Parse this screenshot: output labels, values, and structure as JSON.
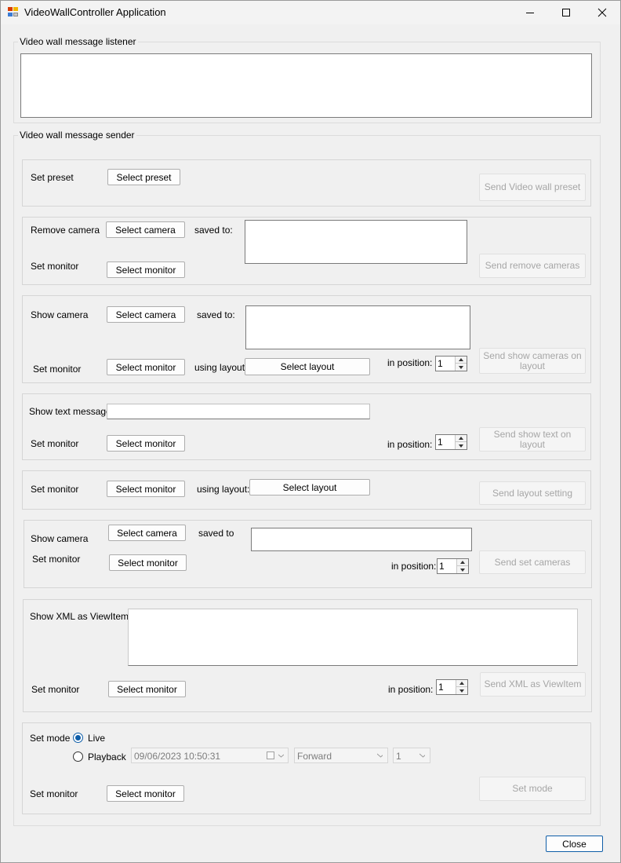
{
  "window": {
    "title": "VideoWallController Application"
  },
  "listener": {
    "title": "Video wall message listener",
    "content": ""
  },
  "sender": {
    "title": "Video wall message sender",
    "preset": {
      "label": "Set preset",
      "select_button": "Select preset",
      "send_button": "Send Video wall preset"
    },
    "remove_camera": {
      "label": "Remove camera",
      "select_camera_button": "Select camera",
      "saved_to_label": "saved to:",
      "set_monitor_label": "Set monitor",
      "select_monitor_button": "Select monitor",
      "send_button": "Send remove cameras"
    },
    "show_camera": {
      "label": "Show camera",
      "select_camera_button": "Select camera",
      "saved_to_label": "saved to:",
      "set_monitor_label": "Set monitor",
      "select_monitor_button": "Select monitor",
      "using_layout_label": "using layout:",
      "select_layout_button": "Select layout",
      "in_position_label": "in position:",
      "position_value": "1",
      "send_button": "Send show cameras on layout"
    },
    "show_text": {
      "label": "Show text message:",
      "text_value": "",
      "set_monitor_label": "Set monitor",
      "select_monitor_button": "Select monitor",
      "in_position_label": "in position:",
      "position_value": "1",
      "send_button": "Send show text on layout"
    },
    "layout_setting": {
      "set_monitor_label": "Set monitor",
      "select_monitor_button": "Select monitor",
      "using_layout_label": "using layout:",
      "select_layout_button": "Select layout",
      "send_button": "Send layout setting"
    },
    "set_cameras": {
      "label": "Show camera",
      "select_camera_button": "Select camera",
      "saved_to_label": "saved to",
      "set_monitor_label": "Set monitor",
      "select_monitor_button": "Select monitor",
      "in_position_label": "in position:",
      "position_value": "1",
      "send_button": "Send set cameras"
    },
    "show_xml": {
      "label": "Show XML as ViewItems:",
      "xml_value": "",
      "set_monitor_label": "Set monitor",
      "select_monitor_button": "Select monitor",
      "in_position_label": "in position:",
      "position_value": "1",
      "send_button": "Send XML as ViewItem"
    },
    "set_mode": {
      "label": "Set mode",
      "live_label": "Live",
      "playback_label": "Playback",
      "selected_mode": "Live",
      "datetime_value": "09/06/2023 10:50:31",
      "direction_value": "Forward",
      "speed_value": "1",
      "set_monitor_label": "Set monitor",
      "select_monitor_button": "Select monitor",
      "send_button": "Set mode"
    }
  },
  "footer": {
    "close_button": "Close"
  }
}
